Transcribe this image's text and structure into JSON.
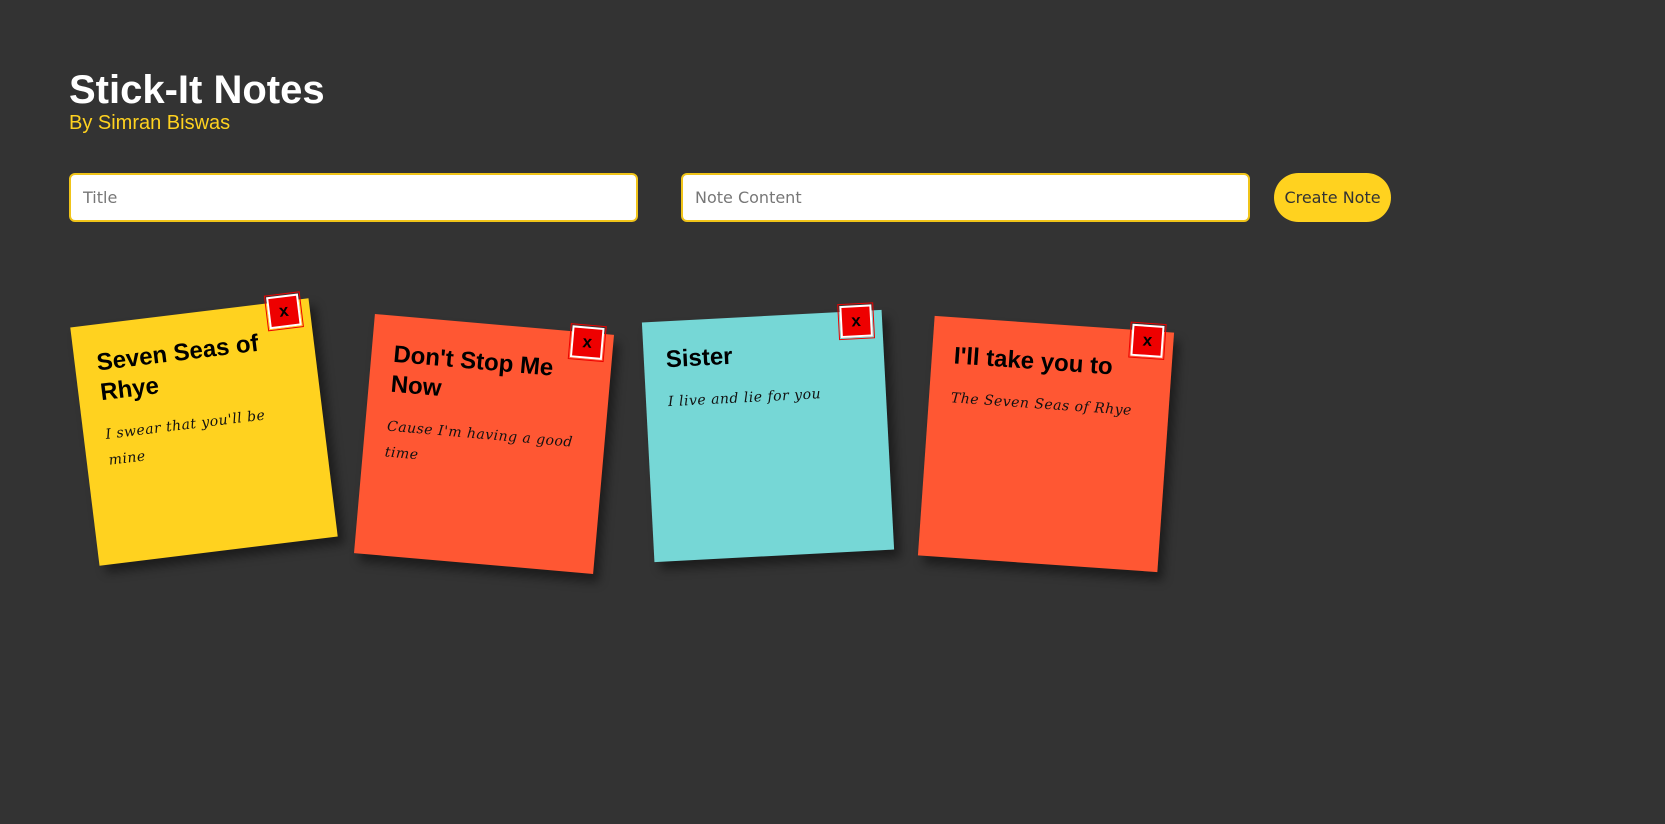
{
  "header": {
    "title": "Stick-It Notes",
    "subtitle": "By Simran Biswas"
  },
  "form": {
    "title_placeholder": "Title",
    "title_value": "",
    "content_placeholder": "Note Content",
    "content_value": "",
    "create_label": "Create Note"
  },
  "colors": {
    "background": "#333333",
    "accent": "#ffd21f",
    "delete": "#ee0000"
  },
  "notes": [
    {
      "title": "Seven Seas of Rhye",
      "content": "I swear that you'll be mine",
      "color": "#ffd21f",
      "delete_label": "x"
    },
    {
      "title": "Don't Stop Me Now",
      "content": "Cause I'm having a good time",
      "color": "#ff5733",
      "delete_label": "x"
    },
    {
      "title": "Sister",
      "content": "I live and lie for you",
      "color": "#76d7d6",
      "delete_label": "x"
    },
    {
      "title": "I'll take you to",
      "content": "The Seven Seas of Rhye",
      "color": "#ff5733",
      "delete_label": "x"
    }
  ]
}
